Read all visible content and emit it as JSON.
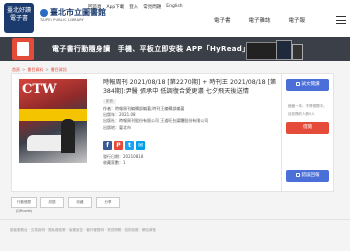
{
  "header": {
    "logo_primary": "臺北好讀 電子書",
    "logo_secondary": "臺北市立圖書館",
    "logo_secondary_en": "TAIPEI PUBLIC LIBRARY",
    "top_links": [
      "回首頁",
      "App下載",
      "登入",
      "常見問題",
      "English"
    ],
    "tabs": [
      "電子書",
      "電子雜誌",
      "電子報"
    ]
  },
  "banner": {
    "text": "電子書行動隨身讀　手機、平板立即安裝 APP「HyRead」"
  },
  "breadcrumb": [
    "首頁",
    "書目資料",
    "書目資訊"
  ],
  "book": {
    "title": "時報周刊 2021/08/18 [第2270期] + 時刊王 2021/08/18 [第384期]:尹醫 張承中 低調復合愛更濃 七夕飛天後送情",
    "label_tag": "影音",
    "author": "作者：時報周刊編輯部編著;時刊王編輯部編著",
    "pub_date": "出版年：2021.08",
    "publisher": "出版社：時報周刊股份有限公司 王道旺台媒體股份有限公司",
    "isbn": "出版地：臺北市",
    "edition": "發行日期：20210818",
    "collection": "收藏家數：1",
    "cover_logo": "CTW"
  },
  "share_buttons": [
    {
      "label": "f",
      "color": "#3b5998"
    },
    {
      "label": "P",
      "color": "#e54b39"
    },
    {
      "label": "t",
      "color": "#1da1f2"
    },
    {
      "label": "✉",
      "color": "#00a0e9"
    }
  ],
  "sidebar": {
    "read_button": "試文閱讀",
    "status_line1": "館藏一本；不得借閱中；",
    "status_line2": "目前預約人數0人",
    "borrow_button": "借閱",
    "report_button": "錯誤回報"
  },
  "bottom_buttons": {
    "qr": "行動借閱(QRcode)",
    "others": [
      "試讀",
      "收藏",
      "分享"
    ]
  },
  "footer": {
    "links": "讀者服務台 · 交易說明 · 隱私權政策 · 版權宣告 · 著作權聲明 · 常見問題 · 諮詢信箱 · 網站導覽"
  },
  "colors": {
    "accent_red": "#e54b39",
    "accent_blue": "#4a6fd9",
    "banner_bg": "#3a3f48"
  }
}
